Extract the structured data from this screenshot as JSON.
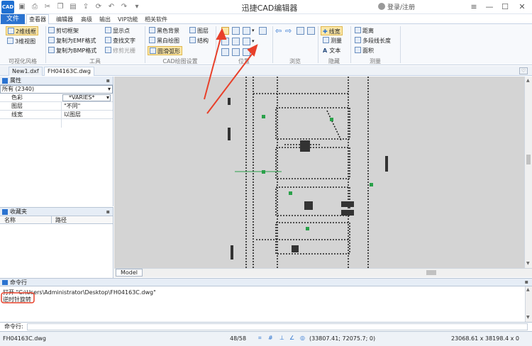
{
  "app": {
    "logo_text": "CAD",
    "title": "迅捷CAD编辑器",
    "user_label": "登录/注册"
  },
  "menu": {
    "file": "文件",
    "viewer": "查看器",
    "editor": "编辑器",
    "advanced": "高级",
    "output": "输出",
    "vip": "VIP功能",
    "related": "相关软件"
  },
  "ribbon": {
    "visual_style": {
      "wire2d": "2维线框",
      "view3d": "3维视图",
      "group_label": "可视化风格"
    },
    "tools": {
      "clip_frame": "剪切框架",
      "copy_emf": "复制为EMF格式",
      "copy_bmp": "复制为BMP格式",
      "show_points": "显示点",
      "find_text": "查找文字",
      "trim_raster": "修剪光栅",
      "group_label": "工具"
    },
    "cad_settings": {
      "black_bg": "黑色背景",
      "bw_drawing": "黑白绘图",
      "smooth_arc": "圆滑弧形",
      "layers": "图层",
      "structure": "结构",
      "group_label": "CAD绘图设置"
    },
    "position": {
      "group_label": "位置"
    },
    "browse": {
      "group_label": "浏览"
    },
    "hide": {
      "linewidth": "线宽",
      "measure": "测量",
      "text": "文本",
      "group_label": "隐藏"
    },
    "measure": {
      "distance": "距离",
      "polyline_length": "多段线长度",
      "area": "面积",
      "group_label": "测量"
    }
  },
  "tabs": [
    "New1.dxf",
    "FH04163C.dwg"
  ],
  "properties": {
    "title": "属性",
    "selector": "所有 (2340)",
    "rows": [
      {
        "name": "色彩",
        "value": "*VARIES*"
      },
      {
        "name": "图层",
        "value": "\"不同\""
      },
      {
        "name": "线宽",
        "value": "以图层"
      }
    ]
  },
  "favorites": {
    "title": "收藏夹",
    "col_name": "名称",
    "col_path": "路径"
  },
  "canvas": {
    "model_tab": "Model"
  },
  "command": {
    "title": "命令行",
    "line1": "打开 \"C:\\Users\\Administrator\\Desktop\\FH04163C.dwg\"",
    "line2": "逆时针旋转",
    "prompt": "命令行:"
  },
  "status": {
    "file": "FH04163C.dwg",
    "pages": "48/58",
    "coords": "(33807.41; 72075.7; 0)",
    "size": "23068.61 x 38198.4 x 0"
  },
  "colors": {
    "accent": "#2b73d0",
    "highlight": "#fbe7a8",
    "annotation": "#e8402a",
    "canvas_bg": "#d4d4d4"
  }
}
